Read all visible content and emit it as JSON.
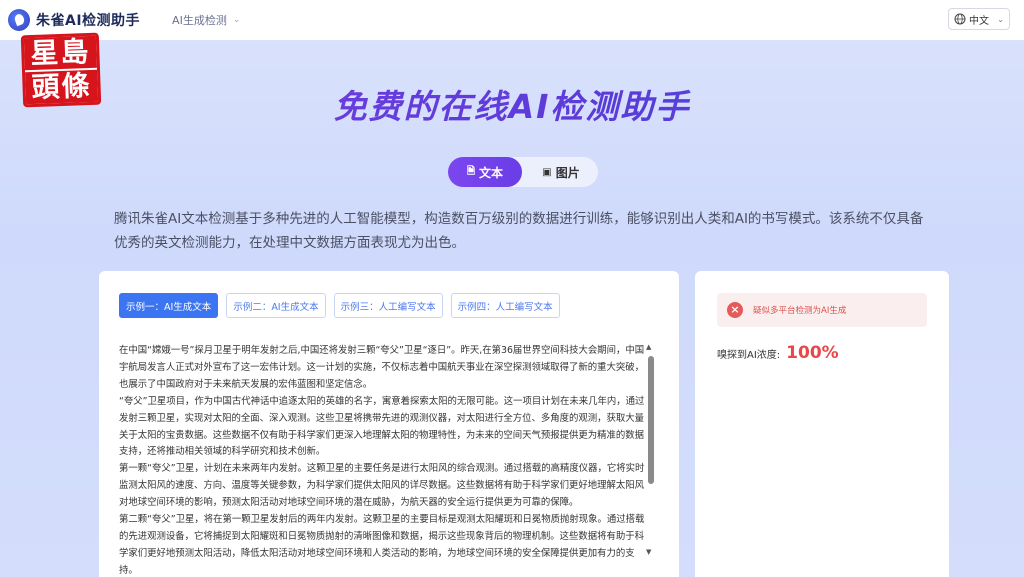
{
  "header": {
    "brand": "朱雀AI检测助手",
    "nav_dropdown": "AI生成检测",
    "language": "中文"
  },
  "watermark": {
    "line1": "星島",
    "line2": "頭條",
    "color": "#d5141c"
  },
  "hero": {
    "title": "免费的在线AI检测助手",
    "mode_text": "文本",
    "mode_image": "图片",
    "intro": "腾讯朱雀AI文本检测基于多种先进的人工智能模型，构造数百万级别的数据进行训练，能够识别出人类和AI的书写模式。该系统不仅具备优秀的英文检测能力，在处理中文数据方面表现尤为出色。"
  },
  "examples": {
    "tabs": [
      "示例一：AI生成文本",
      "示例二：AI生成文本",
      "示例三：人工编写文本",
      "示例四：人工编写文本"
    ],
    "active_index": 0
  },
  "sample_text": {
    "paragraphs": [
      "在中国“嫦娥一号”探月卫星于明年发射之后,中国还将发射三颗“夸父”卫星“逐日”。昨天,在第36届世界空间科技大会期间，中国宇航局发言人正式对外宣布了这一宏伟计划。这一计划的实施，不仅标志着中国航天事业在深空探测领域取得了新的重大突破，也展示了中国政府对于未来航天发展的宏伟蓝图和坚定信念。",
      "“夸父”卫星项目，作为中国古代神话中追逐太阳的英雄的名字，寓意着探索太阳的无限可能。这一项目计划在未来几年内，通过发射三颗卫星，实现对太阳的全面、深入观测。这些卫星将携带先进的观测仪器，对太阳进行全方位、多角度的观测，获取大量关于太阳的宝贵数据。这些数据不仅有助于科学家们更深入地理解太阳的物理特性，为未来的空间天气预报提供更为精准的数据支持，还将推动相关领域的科学研究和技术创新。",
      "第一颗“夸父”卫星，计划在未来两年内发射。这颗卫星的主要任务是进行太阳风的综合观测。通过搭载的高精度仪器，它将实时监测太阳风的速度、方向、温度等关键参数，为科学家们提供太阳风的详尽数据。这些数据将有助于科学家们更好地理解太阳风对地球空间环境的影响，预测太阳活动对地球空间环境的潜在威胁，为航天器的安全运行提供更为可靠的保障。",
      "第二颗“夸父”卫星，将在第一颗卫星发射后的两年内发射。这颗卫星的主要目标是观测太阳耀斑和日冕物质抛射现象。通过搭载的先进观测设备，它将捕捉到太阳耀斑和日冕物质抛射的清晰图像和数据，揭示这些现象背后的物理机制。这些数据将有助于科学家们更好地预测太阳活动，降低太阳活动对地球空间环境和人类活动的影响，为地球空间环境的安全保障提供更加有力的支持。"
    ]
  },
  "result": {
    "alert": "疑似多平台检测为AI生成",
    "score_label": "嗅探到AI浓度:",
    "score_value": "100%",
    "accent": "#e9474a"
  },
  "colors": {
    "primary": "#3c75f2",
    "purple": "#6b3fe0"
  }
}
